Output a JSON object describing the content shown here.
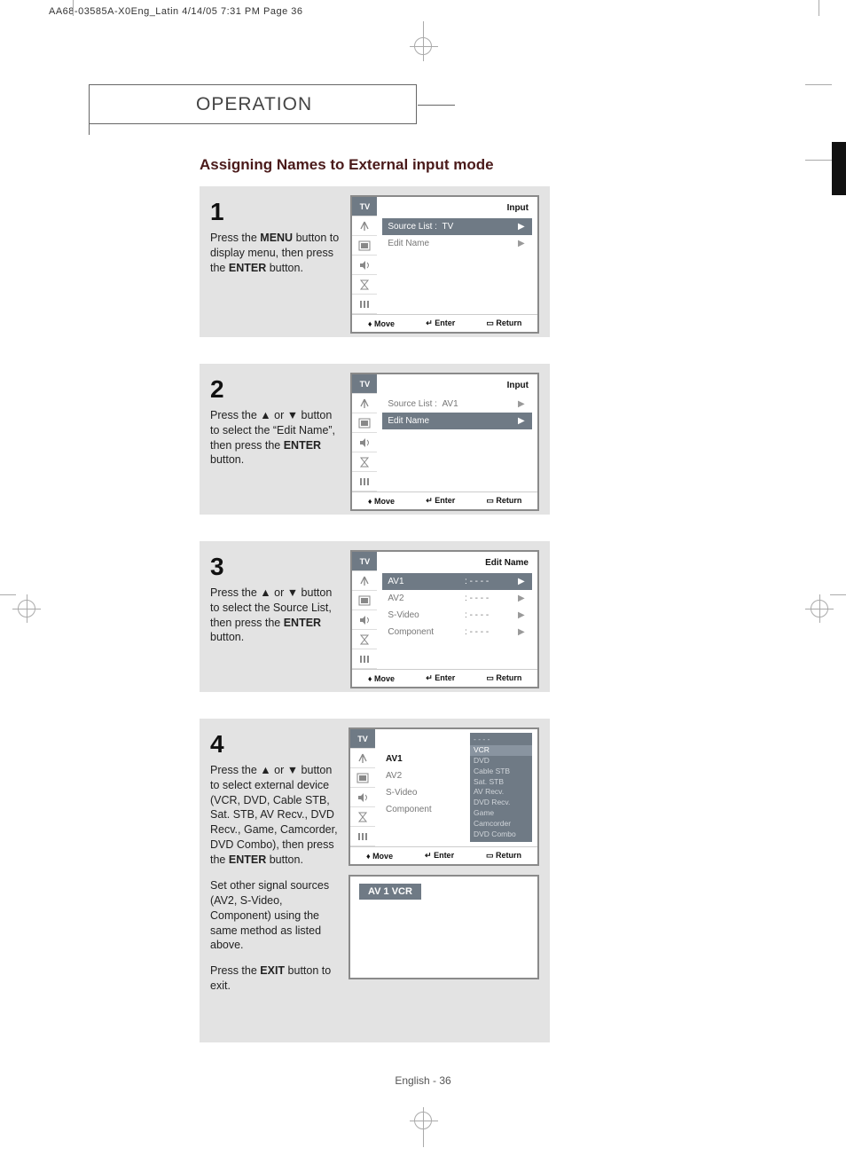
{
  "header_line": "AA68-03585A-X0Eng_Latin  4/14/05  7:31 PM  Page 36",
  "section": "OPERATION",
  "title": "Assigning Names to External input mode",
  "steps": {
    "s1": {
      "num": "1",
      "text_a": "Press the ",
      "b1": "MENU",
      "text_b": " button to display menu, then press the ",
      "b2": "ENTER",
      "text_c": " button."
    },
    "s2": {
      "num": "2",
      "text_a": "Press the ▲ or ▼ button to select the “Edit Name”, then press the ",
      "b1": "ENTER",
      "text_b": " button."
    },
    "s3": {
      "num": "3",
      "text_a": "Press the ▲ or ▼ button to select the Source List, then press the ",
      "b1": "ENTER",
      "text_b": " button."
    },
    "s4": {
      "num": "4",
      "text_a": "Press the ▲ or ▼ button to select external device (VCR, DVD, Cable STB, Sat. STB, AV Recv., DVD Recv., Game, Camcorder, DVD Combo), then press the ",
      "b1": "ENTER",
      "text_b": " button.",
      "para2": "Set other signal sources (AV2, S-Video, Component) using the same method as listed above.",
      "para3_a": "Press the ",
      "para3_b": "EXIT",
      "para3_c": " button to exit."
    }
  },
  "osd": {
    "tv_label": "TV",
    "title_input": "Input",
    "title_editname": "Edit Name",
    "row_source": "Source List",
    "row_editname": "Edit Name",
    "val_tv": "TV",
    "val_av1": "AV1",
    "rows3": [
      {
        "lbl": "AV1",
        "val": "- - - -"
      },
      {
        "lbl": "AV2",
        "val": "- - - -"
      },
      {
        "lbl": "S-Video",
        "val": "- - - -"
      },
      {
        "lbl": "Component",
        "val": "- - - -"
      }
    ],
    "rows4": [
      {
        "lbl": "AV1"
      },
      {
        "lbl": "AV2"
      },
      {
        "lbl": "S-Video"
      },
      {
        "lbl": "Component"
      }
    ],
    "dropdown": [
      "- - - -",
      "VCR",
      "DVD",
      "Cable STB",
      "Sat. STB",
      "AV Recv.",
      "DVD Recv.",
      "Game",
      "Camcorder",
      "DVD Combo"
    ],
    "footer": {
      "move": "Move",
      "enter": "Enter",
      "return": "Return"
    },
    "preview": "AV 1   VCR"
  },
  "page_num": "English - 36"
}
